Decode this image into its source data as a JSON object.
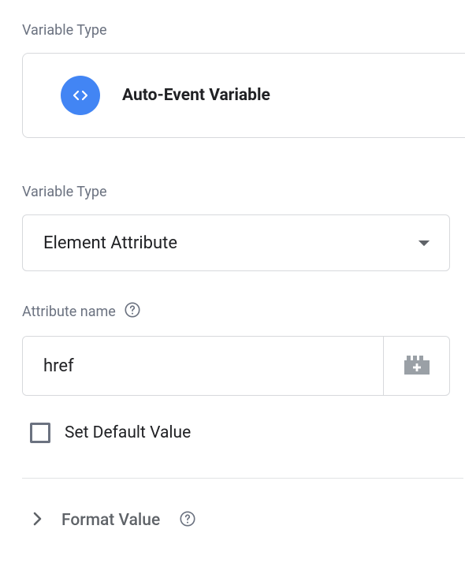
{
  "variable_type_card": {
    "label": "Variable Type",
    "title": "Auto-Event Variable"
  },
  "variable_type_select": {
    "label": "Variable Type",
    "value": "Element Attribute"
  },
  "attribute_name": {
    "label": "Attribute name",
    "value": "href"
  },
  "default_checkbox": {
    "label": "Set Default Value"
  },
  "format_value": {
    "label": "Format Value"
  }
}
